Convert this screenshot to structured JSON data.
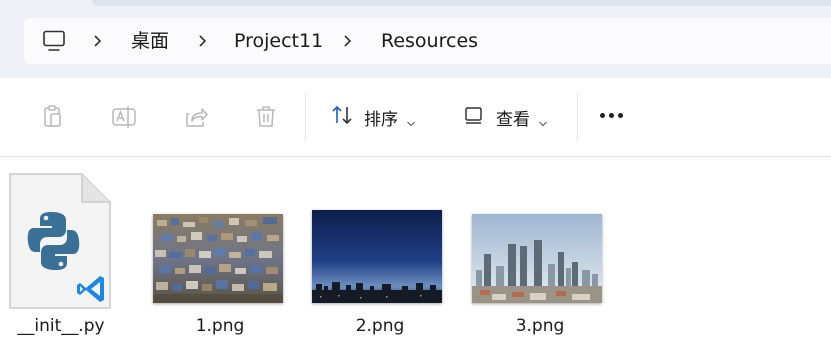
{
  "breadcrumb": {
    "items": [
      "桌面",
      "Project11",
      "Resources"
    ]
  },
  "toolbar": {
    "sort_label": "排序",
    "view_label": "查看"
  },
  "files": [
    {
      "name": "__init__.py",
      "type": "python"
    },
    {
      "name": "1.png",
      "type": "image"
    },
    {
      "name": "2.png",
      "type": "image"
    },
    {
      "name": "3.png",
      "type": "image"
    }
  ],
  "icons": {
    "computer": "computer-icon",
    "copy": "copy-icon",
    "rename": "rename-icon",
    "share": "share-icon",
    "delete": "delete-icon",
    "sort": "sort-icon",
    "view": "view-icon",
    "more": "more-icon"
  },
  "colors": {
    "header_bg": "#eef1f8",
    "python_blue": "#3a6f96",
    "vscode_blue": "#1f88e5"
  }
}
